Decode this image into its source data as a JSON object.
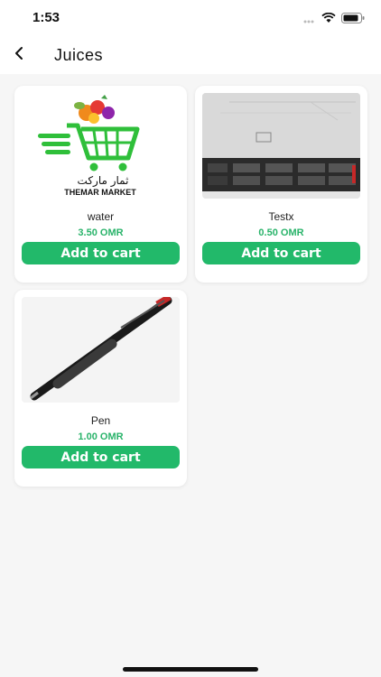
{
  "status": {
    "time": "1:53"
  },
  "header": {
    "title": "Juices",
    "back_icon": "chevron-left-icon"
  },
  "logo": {
    "arabic_text": "ثمار ماركت",
    "latin_text": "THEMAR MARKET"
  },
  "products": [
    {
      "name": "water",
      "price": "3.50 OMR",
      "button": "Add to cart",
      "image": "themar-market-logo"
    },
    {
      "name": "Testx",
      "price": "0.50 OMR",
      "button": "Add to cart",
      "image": "rack-server"
    },
    {
      "name": "Pen",
      "price": "1.00 OMR",
      "button": "Add to cart",
      "image": "pen"
    }
  ],
  "colors": {
    "accent": "#22b96a",
    "price": "#29b36a",
    "background": "#f6f6f6"
  }
}
